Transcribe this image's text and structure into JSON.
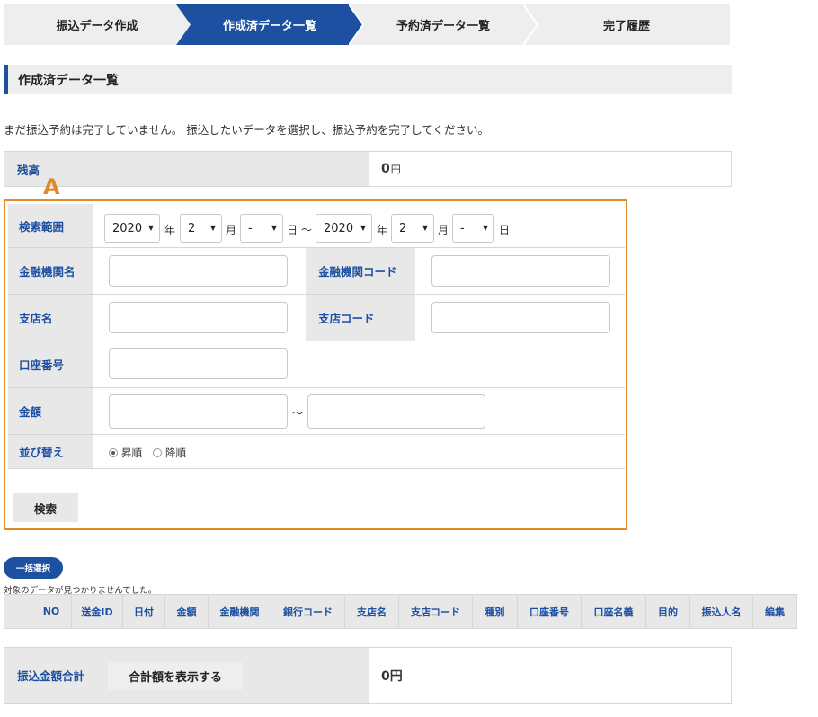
{
  "steps": [
    {
      "label": "振込データ作成"
    },
    {
      "label": "作成済データ一覧"
    },
    {
      "label": "予約済データ一覧"
    },
    {
      "label": "完了履歴"
    }
  ],
  "colors": {
    "brand": "#1e50a2",
    "highlight": "#e08a2c",
    "label_bg": "#e8e8e8"
  },
  "section_title": "作成済データ一覧",
  "notice": "まだ振込予約は完了していません。 振込したいデータを選択し、振込予約を完了してください。",
  "balance": {
    "label": "残高",
    "amount": "0",
    "unit": "円"
  },
  "annotation_mark": "A",
  "search": {
    "range_label": "検索範囲",
    "from": {
      "year": "2020",
      "month": "2",
      "day": "-"
    },
    "to": {
      "year": "2020",
      "month": "2",
      "day": "-"
    },
    "year_unit": "年",
    "month_unit": "月",
    "day_unit": "日",
    "range_sep": "～",
    "bank_name_label": "金融機関名",
    "bank_code_label": "金融機関コード",
    "branch_name_label": "支店名",
    "branch_code_label": "支店コード",
    "account_label": "口座番号",
    "amount_label": "金額",
    "amount_sep": "～",
    "sort_label": "並び替え",
    "sort_options": [
      "昇順",
      "降順"
    ],
    "sort_selected": "昇順",
    "search_button": "検索"
  },
  "select_all": "一括選択",
  "no_data": "対象のデータが見つかりませんでした。",
  "table": {
    "columns": [
      "",
      "NO",
      "送金ID",
      "日付",
      "金額",
      "金融機関",
      "銀行コード",
      "支店名",
      "支店コード",
      "種別",
      "口座番号",
      "口座名義",
      "目的",
      "振込人名",
      "編集"
    ]
  },
  "total": {
    "label": "振込金額合計",
    "button": "合計額を表示する",
    "amount": "0円"
  }
}
